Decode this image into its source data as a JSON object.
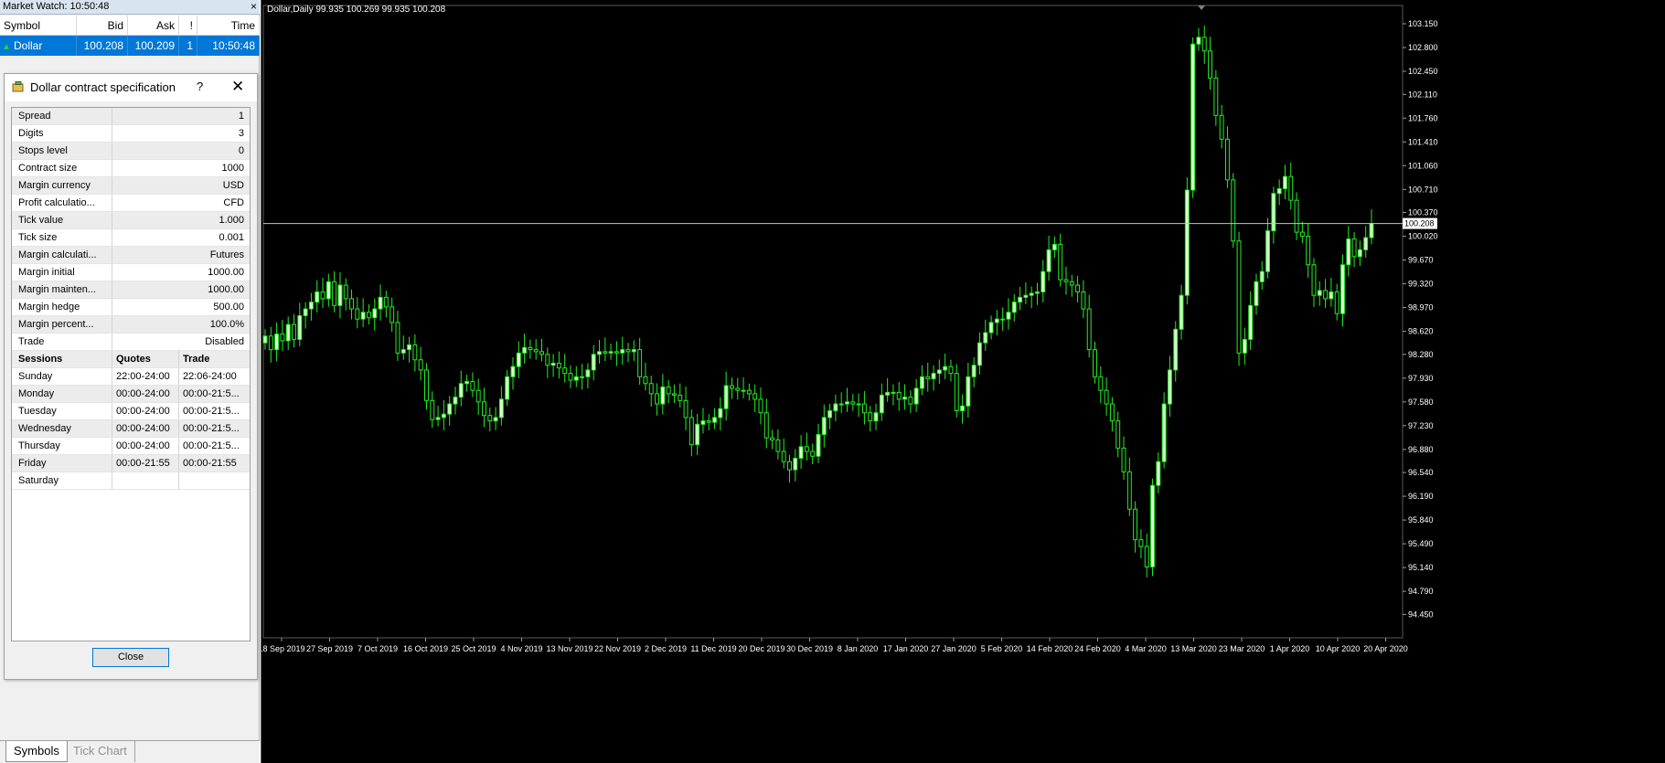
{
  "market_watch": {
    "title": "Market Watch: 10:50:48",
    "close": "×",
    "columns": [
      "Symbol",
      "Bid",
      "Ask",
      "!",
      "Time"
    ],
    "rows": [
      {
        "symbol": "Dollar",
        "bid": "100.208",
        "ask": "100.209",
        "spread": "1",
        "time": "10:50:48"
      }
    ]
  },
  "dialog": {
    "title": "Dollar contract specification",
    "help": "?",
    "close_x": "✕",
    "specs": [
      {
        "key": "Spread",
        "value": "1"
      },
      {
        "key": "Digits",
        "value": "3"
      },
      {
        "key": "Stops level",
        "value": "0"
      },
      {
        "key": "Contract size",
        "value": "1000"
      },
      {
        "key": "Margin currency",
        "value": "USD"
      },
      {
        "key": "Profit calculatio...",
        "value": "CFD"
      },
      {
        "key": "Tick value",
        "value": "1.000"
      },
      {
        "key": "Tick size",
        "value": "0.001"
      },
      {
        "key": "Margin calculati...",
        "value": "Futures"
      },
      {
        "key": "Margin initial",
        "value": "1000.00"
      },
      {
        "key": "Margin mainten...",
        "value": "1000.00"
      },
      {
        "key": "Margin hedge",
        "value": "500.00"
      },
      {
        "key": "Margin percent...",
        "value": "100.0%"
      },
      {
        "key": "Trade",
        "value": "Disabled"
      }
    ],
    "sessions_header": {
      "day": "Sessions",
      "quotes": "Quotes",
      "trade": "Trade"
    },
    "sessions": [
      {
        "day": "Sunday",
        "quotes": "22:00-24:00",
        "trade": "22:06-24:00"
      },
      {
        "day": "Monday",
        "quotes": "00:00-24:00",
        "trade": "00:00-21:5..."
      },
      {
        "day": "Tuesday",
        "quotes": "00:00-24:00",
        "trade": "00:00-21:5..."
      },
      {
        "day": "Wednesday",
        "quotes": "00:00-24:00",
        "trade": "00:00-21:5..."
      },
      {
        "day": "Thursday",
        "quotes": "00:00-24:00",
        "trade": "00:00-21:5..."
      },
      {
        "day": "Friday",
        "quotes": "00:00-21:55",
        "trade": "00:00-21:55"
      },
      {
        "day": "Saturday",
        "quotes": "",
        "trade": ""
      }
    ],
    "close_button": "Close"
  },
  "tabs": {
    "symbols": "Symbols",
    "tick_chart": "Tick Chart"
  },
  "chart_data": {
    "type": "candlestick",
    "header": "Dollar,Daily  99.935 100.269 99.935 100.208",
    "current_price": 100.208,
    "current_price_label": "100.208",
    "ylim": [
      94.455,
      103.15
    ],
    "y_ticks": [
      "103.150",
      "102.800",
      "102.450",
      "102.110",
      "101.760",
      "101.410",
      "101.060",
      "100.710",
      "100.370",
      "100.020",
      "99.670",
      "99.320",
      "98.970",
      "98.620",
      "98.280",
      "97.930",
      "97.580",
      "97.230",
      "96.880",
      "96.540",
      "96.190",
      "95.840",
      "95.490",
      "95.140",
      "94.790",
      "94.450"
    ],
    "x_ticks": [
      "18 Sep 2019",
      "27 Sep 2019",
      "7 Oct 2019",
      "16 Oct 2019",
      "25 Oct 2019",
      "4 Nov 2019",
      "13 Nov 2019",
      "22 Nov 2019",
      "2 Dec 2019",
      "11 Dec 2019",
      "20 Dec 2019",
      "30 Dec 2019",
      "8 Jan 2020",
      "17 Jan 2020",
      "27 Jan 2020",
      "5 Feb 2020",
      "14 Feb 2020",
      "24 Feb 2020",
      "4 Mar 2020",
      "13 Mar 2020",
      "23 Mar 2020",
      "1 Apr 2020",
      "10 Apr 2020",
      "20 Apr 2020"
    ],
    "colors": {
      "background": "#000000",
      "bull_body": "#ddffd0",
      "bear_body": "#000000",
      "wick": "#22ee22",
      "grid_line": "#a8d8a8",
      "axis_text": "#ffffff"
    },
    "closes": [
      98.55,
      98.35,
      98.58,
      98.48,
      98.72,
      98.5,
      98.85,
      98.95,
      99.05,
      99.2,
      99.1,
      99.35,
      99.0,
      99.3,
      99.1,
      98.95,
      98.8,
      98.9,
      98.82,
      98.95,
      99.12,
      98.98,
      98.75,
      98.3,
      98.35,
      98.42,
      98.2,
      98.05,
      97.6,
      97.32,
      97.35,
      97.4,
      97.55,
      97.65,
      97.85,
      97.88,
      97.75,
      97.58,
      97.38,
      97.3,
      97.35,
      97.62,
      97.95,
      98.1,
      98.3,
      98.38,
      98.35,
      98.32,
      98.28,
      98.12,
      98.15,
      98.08,
      98.0,
      97.9,
      97.95,
      97.95,
      98.05,
      98.28,
      98.32,
      98.3,
      98.32,
      98.3,
      98.35,
      98.32,
      98.35,
      97.95,
      97.85,
      97.7,
      97.55,
      97.8,
      97.7,
      97.68,
      97.6,
      97.35,
      96.95,
      97.25,
      97.3,
      97.28,
      97.35,
      97.48,
      97.82,
      97.78,
      97.75,
      97.75,
      97.7,
      97.62,
      97.42,
      97.05,
      97.02,
      96.85,
      96.7,
      96.58,
      96.75,
      96.92,
      96.85,
      96.78,
      97.1,
      97.35,
      97.45,
      97.55,
      97.55,
      97.58,
      97.55,
      97.55,
      97.42,
      97.3,
      97.42,
      97.68,
      97.72,
      97.72,
      97.62,
      97.65,
      97.55,
      97.78,
      97.95,
      97.92,
      98.0,
      98.05,
      98.1,
      98.0,
      97.45,
      97.52,
      97.95,
      98.12,
      98.45,
      98.6,
      98.75,
      98.8,
      98.8,
      98.9,
      99.05,
      99.12,
      99.15,
      99.18,
      99.2,
      99.5,
      99.82,
      99.9,
      99.38,
      99.35,
      99.3,
      99.2,
      98.95,
      98.35,
      97.95,
      97.75,
      97.55,
      97.3,
      96.9,
      96.55,
      96.0,
      95.55,
      95.45,
      95.15,
      96.35,
      96.7,
      97.55,
      98.05,
      98.65,
      99.15,
      100.7,
      102.85,
      102.95,
      102.75,
      102.35,
      101.8,
      101.45,
      100.85,
      99.95,
      98.3,
      98.5,
      99.0,
      99.35,
      99.5,
      100.1,
      100.65,
      100.72,
      100.9,
      100.55,
      100.08,
      100.02,
      99.6,
      99.15,
      99.22,
      99.1,
      99.2,
      98.88,
      99.6,
      99.98,
      99.72,
      99.82,
      100.0,
      100.208
    ]
  }
}
